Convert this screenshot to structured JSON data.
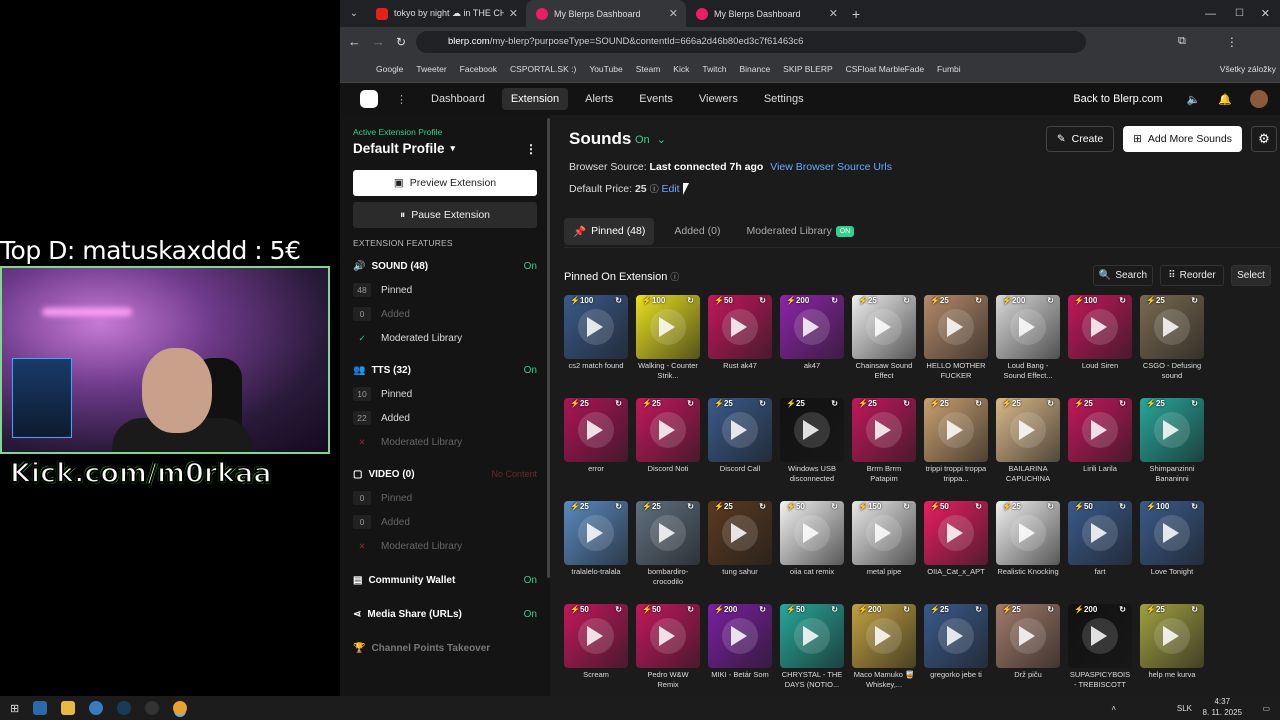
{
  "stream": {
    "donor_text": "Top D: matuskaxddd : 5€",
    "kick_text": "Kick.com/m0rkaa"
  },
  "browser": {
    "tabs": [
      {
        "label": "tokyo by night ☁ in THE CH"
      },
      {
        "label": "My Blerps Dashboard"
      },
      {
        "label": "My Blerps Dashboard"
      }
    ],
    "url_domain": "blerp.com",
    "url_path": "/my-blerp?purposeType=SOUND&contentId=666a2d46b80ed3c7f61463c6",
    "bookmarks": [
      "Google",
      "Tweeter",
      "Facebook",
      "CSPORTAL.SK :)",
      "YouTube",
      "Steam",
      "Kick",
      "Twitch",
      "Binance",
      "SKIP BLERP",
      "CSFloat MarbleFade",
      "Fumbi"
    ],
    "all_bookmarks": "Všetky záložky"
  },
  "nav": {
    "items": [
      "Dashboard",
      "Extension",
      "Alerts",
      "Events",
      "Viewers",
      "Settings"
    ],
    "back": "Back to Blerp.com"
  },
  "sidebar": {
    "active_label": "Active Extension Profile",
    "profile": "Default Profile",
    "preview": "Preview Extension",
    "pause": "Pause Extension",
    "features_label": "EXTENSION FEATURES",
    "sound": {
      "title": "SOUND (48)",
      "status": "On",
      "pinned_n": "48",
      "pinned": "Pinned",
      "added_n": "0",
      "added": "Added",
      "mod": "Moderated Library"
    },
    "tts": {
      "title": "TTS (32)",
      "status": "On",
      "pinned_n": "10",
      "pinned": "Pinned",
      "added_n": "22",
      "added": "Added",
      "mod": "Moderated Library"
    },
    "video": {
      "title": "VIDEO (0)",
      "status": "No Content",
      "pinned_n": "0",
      "pinned": "Pinned",
      "added_n": "0",
      "added": "Added",
      "mod": "Moderated Library"
    },
    "wallet": {
      "title": "Community Wallet",
      "status": "On"
    },
    "media": {
      "title": "Media Share (URLs)",
      "status": "On"
    },
    "channel": {
      "title": "Channel Points Takeover"
    }
  },
  "main": {
    "title": "Sounds",
    "on": "On",
    "browser_source_label": "Browser Source:",
    "browser_source_value": "Last connected 7h ago",
    "browser_source_link": "View Browser Source Urls",
    "price_label": "Default Price:",
    "price_value": "25",
    "price_edit": "Edit",
    "create": "Create",
    "add_more": "Add More Sounds",
    "tabs": {
      "pinned": "Pinned (48)",
      "added": "Added (0)",
      "mod": "Moderated Library",
      "mod_badge": "ON"
    },
    "section_title": "Pinned On Extension",
    "search": "Search",
    "reorder": "Reorder",
    "select": "Select"
  },
  "sounds": [
    {
      "name": "cs2 match found",
      "price": "100",
      "color": "#3a5a8a"
    },
    {
      "name": "Walking - Counter Strik...",
      "price": "100",
      "color": "#e8e020"
    },
    {
      "name": "Rust ak47",
      "price": "50",
      "color": "#c2185b"
    },
    {
      "name": "ak47",
      "price": "200",
      "color": "#8e24aa"
    },
    {
      "name": "Chainsaw Sound Effect",
      "price": "25",
      "color": "#eeeeee"
    },
    {
      "name": "HELLO MOTHER FUCKER",
      "price": "25",
      "color": "#b48a6a"
    },
    {
      "name": "Loud Bang - Sound Effect...",
      "price": "200",
      "color": "#d8d8d8"
    },
    {
      "name": "Loud Siren",
      "price": "100",
      "color": "#c2185b"
    },
    {
      "name": "CSGO - Defusing sound",
      "price": "25",
      "color": "#7a6a50"
    },
    {
      "name": "error",
      "price": "25",
      "color": "#ad1457"
    },
    {
      "name": "Discord Noti",
      "price": "25",
      "color": "#c2185b"
    },
    {
      "name": "Discord Call",
      "price": "25",
      "color": "#3a5a8a"
    },
    {
      "name": "Windows USB disconnected",
      "price": "25",
      "color": "#111111"
    },
    {
      "name": "Brrm Brrm Patapim",
      "price": "25",
      "color": "#c2185b"
    },
    {
      "name": "trippi troppi troppa trippa...",
      "price": "25",
      "color": "#c9a070"
    },
    {
      "name": "BAILARINA CAPUCHINA",
      "price": "25",
      "color": "#d9b88a"
    },
    {
      "name": "Lirili Larila",
      "price": "25",
      "color": "#c2185b"
    },
    {
      "name": "Shimpanzinni Bananinni",
      "price": "25",
      "color": "#26a69a"
    },
    {
      "name": "tralalelo-tralala",
      "price": "25",
      "color": "#5a8ac0"
    },
    {
      "name": "bombardiro-crocodilo",
      "price": "25",
      "color": "#607080"
    },
    {
      "name": "tung sahur",
      "price": "25",
      "color": "#5a3a20"
    },
    {
      "name": "oiia cat remix",
      "price": "50",
      "color": "#f2f2f2"
    },
    {
      "name": "metal pipe",
      "price": "150",
      "color": "#e8e8e8"
    },
    {
      "name": "OIIA_Cat_x_APT",
      "price": "50",
      "color": "#e91e63"
    },
    {
      "name": "Realistic Knocking",
      "price": "25",
      "color": "#f0f0f0"
    },
    {
      "name": "fart",
      "price": "50",
      "color": "#3a5a8a"
    },
    {
      "name": "Love Tonight",
      "price": "100",
      "color": "#3a5a8a"
    },
    {
      "name": "Scream",
      "price": "50",
      "color": "#c2185b"
    },
    {
      "name": "Pedro W&W Remix",
      "price": "50",
      "color": "#c2185b"
    },
    {
      "name": "MIKI - Betár Som",
      "price": "200",
      "color": "#7b1fa2"
    },
    {
      "name": "CHRYSTAL - THE DAYS (NOTIO...",
      "price": "50",
      "color": "#26a69a"
    },
    {
      "name": "Maco Mamuko 🥃 Whiskey,...",
      "price": "200",
      "color": "#c0a040"
    },
    {
      "name": "gregorko jebe ti",
      "price": "25",
      "color": "#3a5a8a"
    },
    {
      "name": "Drž piču",
      "price": "25",
      "color": "#a07a6a"
    },
    {
      "name": "SUPASPICYBOIS - TREBISCOTT",
      "price": "200",
      "color": "#111111"
    },
    {
      "name": "help me kurva",
      "price": "25",
      "color": "#a0a040"
    }
  ],
  "taskbar": {
    "time": "4:37",
    "date": "8. 11. 2025",
    "lang": "SLK"
  }
}
